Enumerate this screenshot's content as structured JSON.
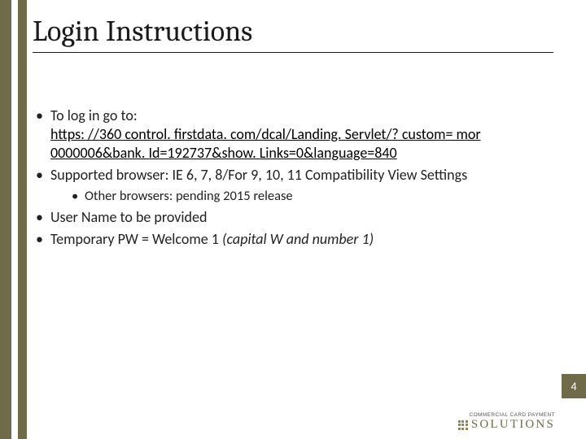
{
  "title": "Login Instructions",
  "bullets": {
    "login_label": "To log in go to:",
    "login_url": "https: //360 control. firstdata. com/dcal/Landing. Servlet/? custom= mor 0000006&bank. Id=192737&show. Links=0&language=840",
    "browser": "Supported browser: IE 6, 7, 8/For 9, 10, 11 Compatibility View Settings",
    "browser_sub": "Other browsers: pending 2015 release",
    "username": "User Name to be provided",
    "pw_prefix": "Temporary PW = Welcome 1 ",
    "pw_note": "(capital W and number 1)"
  },
  "page_number": "4",
  "footer": {
    "small": "COMMERCIAL CARD PAYMENT",
    "big": "SOLUTIONS"
  }
}
